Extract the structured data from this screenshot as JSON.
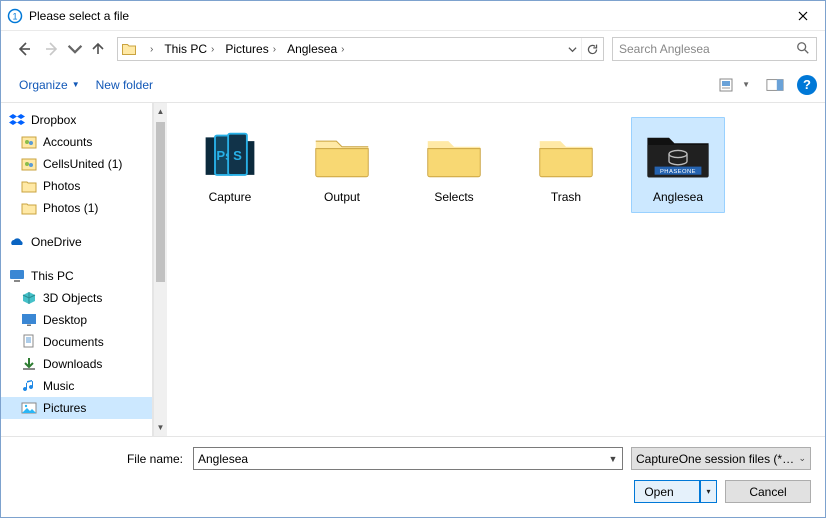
{
  "title": "Please select a file",
  "breadcrumbs": [
    "This PC",
    "Pictures",
    "Anglesea"
  ],
  "search": {
    "placeholder": "Search Anglesea"
  },
  "toolbar": {
    "organize": "Organize",
    "new_folder": "New folder"
  },
  "tree": {
    "dropbox": "Dropbox",
    "dropbox_children": [
      "Accounts",
      "CellsUnited (1)",
      "Photos",
      "Photos (1)"
    ],
    "onedrive": "OneDrive",
    "thispc": "This PC",
    "thispc_children": [
      "3D Objects",
      "Desktop",
      "Documents",
      "Downloads",
      "Music",
      "Pictures"
    ]
  },
  "items": [
    {
      "label": "Capture",
      "kind": "capture-folder"
    },
    {
      "label": "Output",
      "kind": "folder"
    },
    {
      "label": "Selects",
      "kind": "folder"
    },
    {
      "label": "Trash",
      "kind": "folder"
    },
    {
      "label": "Anglesea",
      "kind": "phaseone",
      "selected": true
    }
  ],
  "footer": {
    "filename_label": "File name:",
    "filename_value": "Anglesea",
    "filter_label": "CaptureOne session files (*.col, ",
    "open": "Open",
    "cancel": "Cancel"
  },
  "colors": {
    "accent": "#0078d7",
    "sel_bg": "#cce8ff"
  }
}
